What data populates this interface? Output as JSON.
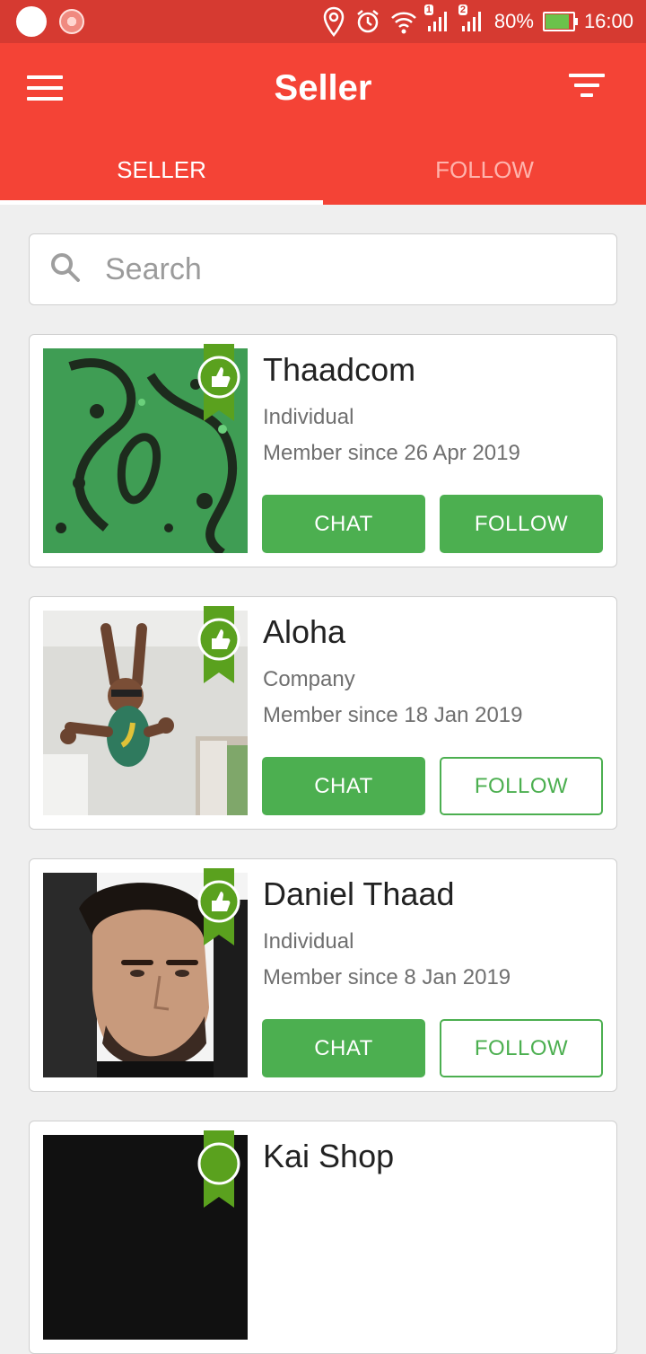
{
  "status_bar": {
    "battery": "80%",
    "time": "16:00",
    "sim_badge_1": "1",
    "sim_badge_2": "2"
  },
  "app_bar": {
    "title": "Seller"
  },
  "tabs": [
    {
      "label": "SELLER",
      "active": true
    },
    {
      "label": "FOLLOW",
      "active": false
    }
  ],
  "search": {
    "placeholder": "Search"
  },
  "sellers": [
    {
      "name": "Thaadcom",
      "type": "Individual",
      "since": "Member since 26 Apr 2019",
      "chat_label": "CHAT",
      "follow_label": "FOLLOW",
      "following": true
    },
    {
      "name": "Aloha",
      "type": "Company",
      "since": "Member since 18 Jan 2019",
      "chat_label": "CHAT",
      "follow_label": "FOLLOW",
      "following": false
    },
    {
      "name": "Daniel Thaad",
      "type": "Individual",
      "since": "Member since 8 Jan 2019",
      "chat_label": "CHAT",
      "follow_label": "FOLLOW",
      "following": false
    },
    {
      "name": "Kai Shop"
    }
  ],
  "colors": {
    "status_bar": "#d63a31",
    "app_bar": "#f44336",
    "accent_green": "#4caf50",
    "background": "#efefef"
  }
}
